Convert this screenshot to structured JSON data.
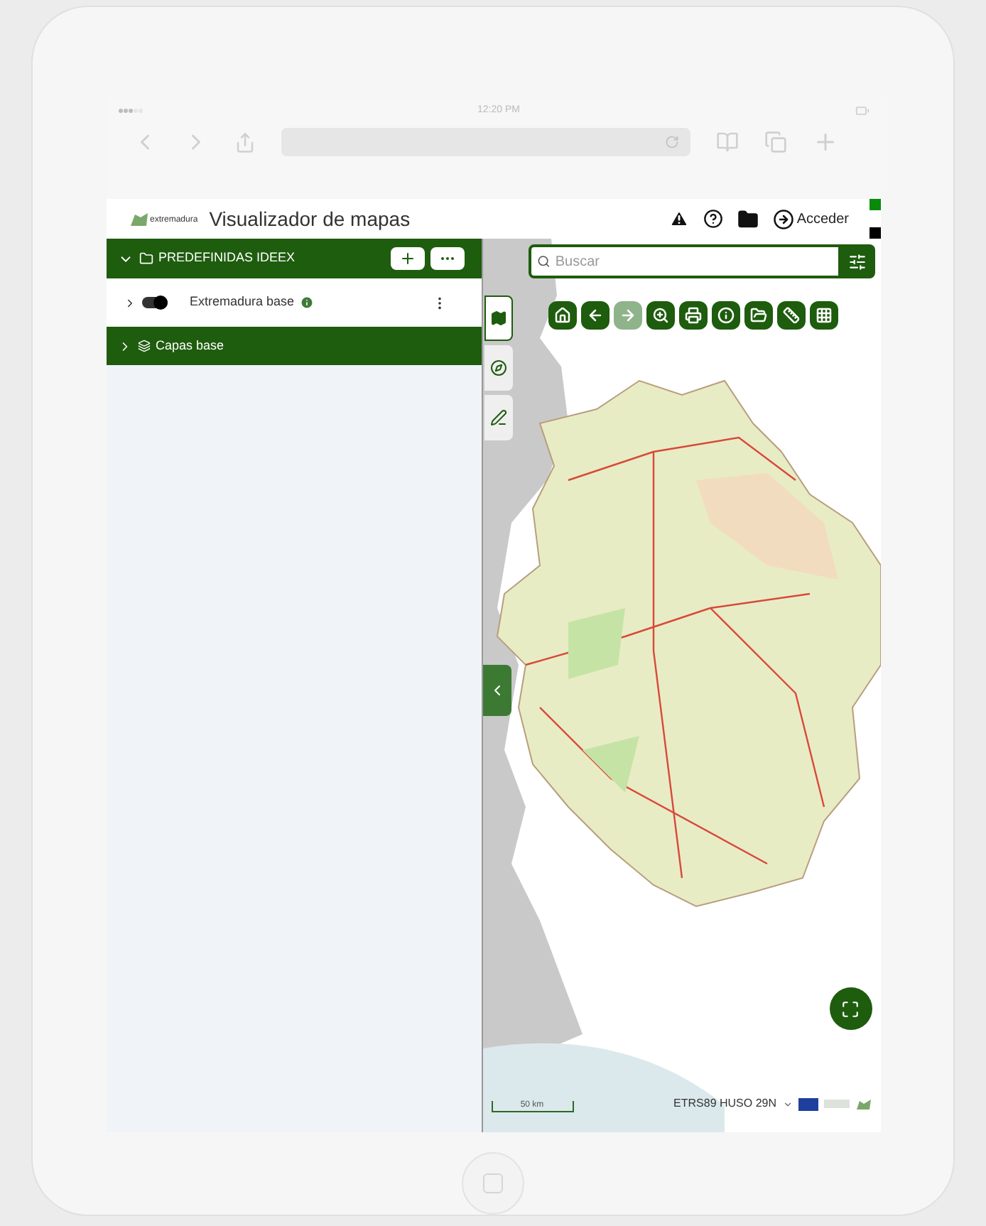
{
  "status_bar": {
    "time": "12:20 PM"
  },
  "app": {
    "title": "Visualizador de mapas",
    "logo_text": "extremadura",
    "header_actions": [
      {
        "kind": "warning"
      },
      {
        "kind": "help"
      },
      {
        "kind": "folder"
      },
      {
        "kind": "login",
        "label": "Acceder"
      }
    ]
  },
  "layers_panel": {
    "group": {
      "title": "PREDEFINIDAS IDEEX",
      "expanded": true,
      "layers": [
        {
          "name": "Extremadura base",
          "on": true
        }
      ]
    },
    "base_group": {
      "title": "Capas base",
      "expanded": false
    }
  },
  "map": {
    "search": {
      "placeholder": "Buscar"
    },
    "tools": [
      {
        "kind": "home",
        "disabled": false
      },
      {
        "kind": "back",
        "disabled": false
      },
      {
        "kind": "forward",
        "disabled": true
      },
      {
        "kind": "zoom",
        "disabled": false
      },
      {
        "kind": "print",
        "disabled": false
      },
      {
        "kind": "info",
        "disabled": false
      },
      {
        "kind": "folder",
        "disabled": false
      },
      {
        "kind": "measure",
        "disabled": false
      },
      {
        "kind": "grid",
        "disabled": false
      }
    ],
    "side_tabs": [
      {
        "kind": "layers",
        "selected": true
      },
      {
        "kind": "compass",
        "selected": false
      },
      {
        "kind": "draw",
        "selected": false
      }
    ],
    "scale": "50 km",
    "projection": "ETRS89 HUSO 29N"
  }
}
